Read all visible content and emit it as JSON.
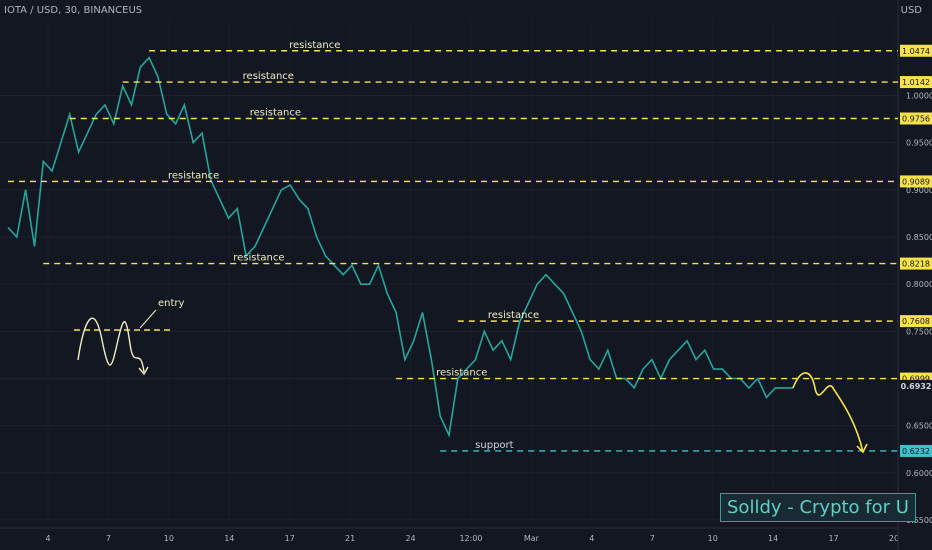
{
  "header": {
    "symbol_title": "IOTA / USD, 30, BINANCEUS",
    "currency": "USD"
  },
  "watermark": "Solldy - Crypto for U",
  "chart_data": {
    "type": "line",
    "title": "IOTA / USD, 30, BINANCEUS",
    "ylim": [
      0.55,
      1.08
    ],
    "y_ticks": [
      "0.5500",
      "0.6000",
      "0.6500",
      "0.7000",
      "0.7500",
      "0.8000",
      "0.8500",
      "0.9000",
      "0.9500",
      "1.0000"
    ],
    "x_ticks": [
      "4",
      "7",
      "10",
      "14",
      "17",
      "21",
      "24",
      "12:00",
      "Mar",
      "4",
      "7",
      "10",
      "14",
      "17",
      "20"
    ],
    "x_range": [
      0,
      100
    ],
    "series": [
      {
        "color": "#26a69a",
        "points": [
          [
            0,
            0.86
          ],
          [
            1,
            0.85
          ],
          [
            2,
            0.9
          ],
          [
            3,
            0.84
          ],
          [
            4,
            0.93
          ],
          [
            5,
            0.92
          ],
          [
            6,
            0.95
          ],
          [
            7,
            0.98
          ],
          [
            8,
            0.94
          ],
          [
            9,
            0.96
          ],
          [
            10,
            0.98
          ],
          [
            11,
            0.99
          ],
          [
            12,
            0.97
          ],
          [
            13,
            1.01
          ],
          [
            14,
            0.99
          ],
          [
            15,
            1.03
          ],
          [
            16,
            1.04
          ],
          [
            17,
            1.02
          ],
          [
            18,
            0.98
          ],
          [
            19,
            0.97
          ],
          [
            20,
            0.99
          ],
          [
            21,
            0.95
          ],
          [
            22,
            0.96
          ],
          [
            23,
            0.91
          ],
          [
            24,
            0.89
          ],
          [
            25,
            0.87
          ],
          [
            26,
            0.88
          ],
          [
            27,
            0.83
          ],
          [
            28,
            0.84
          ],
          [
            29,
            0.86
          ],
          [
            30,
            0.88
          ],
          [
            31,
            0.9
          ],
          [
            32,
            0.905
          ],
          [
            33,
            0.89
          ],
          [
            34,
            0.88
          ],
          [
            35,
            0.85
          ],
          [
            36,
            0.83
          ],
          [
            37,
            0.82
          ],
          [
            38,
            0.81
          ],
          [
            39,
            0.82
          ],
          [
            40,
            0.8
          ],
          [
            41,
            0.8
          ],
          [
            42,
            0.82
          ],
          [
            43,
            0.79
          ],
          [
            44,
            0.77
          ],
          [
            45,
            0.72
          ],
          [
            46,
            0.74
          ],
          [
            47,
            0.77
          ],
          [
            48,
            0.72
          ],
          [
            49,
            0.66
          ],
          [
            50,
            0.64
          ],
          [
            51,
            0.7
          ],
          [
            52,
            0.71
          ],
          [
            53,
            0.72
          ],
          [
            54,
            0.75
          ],
          [
            55,
            0.73
          ],
          [
            56,
            0.74
          ],
          [
            57,
            0.72
          ],
          [
            58,
            0.76
          ],
          [
            59,
            0.78
          ],
          [
            60,
            0.8
          ],
          [
            61,
            0.81
          ],
          [
            62,
            0.8
          ],
          [
            63,
            0.79
          ],
          [
            64,
            0.77
          ],
          [
            65,
            0.75
          ],
          [
            66,
            0.72
          ],
          [
            67,
            0.71
          ],
          [
            68,
            0.73
          ],
          [
            69,
            0.7
          ],
          [
            70,
            0.7
          ],
          [
            71,
            0.69
          ],
          [
            72,
            0.71
          ],
          [
            73,
            0.72
          ],
          [
            74,
            0.7
          ],
          [
            75,
            0.72
          ],
          [
            76,
            0.73
          ],
          [
            77,
            0.74
          ],
          [
            78,
            0.72
          ],
          [
            79,
            0.73
          ],
          [
            80,
            0.71
          ],
          [
            81,
            0.71
          ],
          [
            82,
            0.7
          ],
          [
            83,
            0.7
          ],
          [
            84,
            0.69
          ],
          [
            85,
            0.7
          ],
          [
            86,
            0.68
          ],
          [
            87,
            0.69
          ],
          [
            88,
            0.69
          ],
          [
            89,
            0.69
          ]
        ]
      }
    ],
    "levels": [
      {
        "label": "resistance",
        "value": 1.0474,
        "tag": "1.0474",
        "color": "#f7e24a",
        "x_start": 16
      },
      {
        "label": "resistance",
        "value": 1.0142,
        "tag": "1.0142",
        "color": "#f7e24a",
        "x_start": 13
      },
      {
        "label": "resistance",
        "value": 0.9756,
        "tag": "0.9756",
        "color": "#f7e24a",
        "x_start": 7
      },
      {
        "label": "resistance",
        "value": 0.9089,
        "tag": "0.9089",
        "color": "#f7e24a",
        "x_start": 0
      },
      {
        "label": "resistance",
        "value": 0.8218,
        "tag": "0.8218",
        "color": "#f7e24a",
        "x_start": 4
      },
      {
        "label": "resistance",
        "value": 0.7608,
        "tag": "0.7608",
        "color": "#f7e24a",
        "x_start": 51
      },
      {
        "label": "resistance",
        "value": 0.6999,
        "tag": "0.6999",
        "color": "#f7e24a",
        "x_start": 44
      },
      {
        "label": "support",
        "value": 0.6232,
        "tag": "0.6232",
        "color": "#3ec1c9",
        "x_start": 49
      }
    ],
    "last_price": {
      "value": 0.6932,
      "tag": "0.6932"
    },
    "annotations": [
      {
        "text": "entry"
      }
    ]
  }
}
